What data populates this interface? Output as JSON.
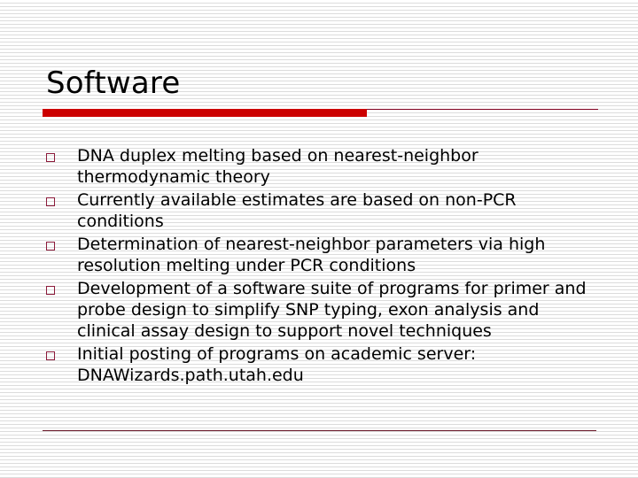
{
  "slide": {
    "title": "Software",
    "accent_color": "#cc0000",
    "bullet_icon": "hollow-square",
    "bullets": [
      {
        "text": "DNA duplex melting based on nearest-neighbor thermodynamic theory"
      },
      {
        "text": "Currently available estimates are based on non-PCR conditions"
      },
      {
        "text": "Determination of nearest-neighbor parameters via high resolution melting under PCR conditions"
      },
      {
        "text": "Development of a software suite of programs for primer and probe design to simplify SNP typing, exon analysis and clinical assay design to support novel techniques"
      },
      {
        "text": "Initial posting of programs on academic server: DNAWizards.path.utah.edu"
      }
    ]
  }
}
